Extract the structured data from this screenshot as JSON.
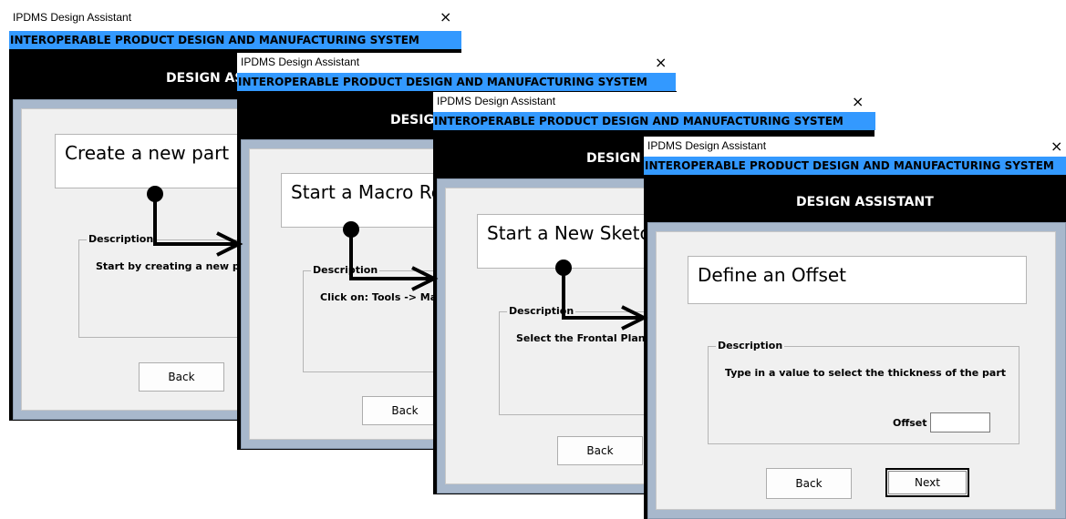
{
  "colors": {
    "banner_blue": "#3399ff",
    "black_band": "#000000",
    "frame_blue_gray": "#a8b8cc",
    "panel_gray": "#f0f0f0"
  },
  "windows": [
    {
      "title": "IPDMS Design Assistant",
      "close_icon": "×",
      "banner": "INTEROPERABLE PRODUCT DESIGN AND MANUFACTURING SYSTEM",
      "heading": "DESIGN ASSISTANT",
      "step": "Create a new part",
      "description_label": "Description",
      "description_text": "Start by creating a new part",
      "back_label": "Back"
    },
    {
      "title": "IPDMS Design Assistant",
      "close_icon": "×",
      "banner": "INTEROPERABLE PRODUCT DESIGN AND MANUFACTURING SYSTEM",
      "heading": "DESIGN ASSISTANT",
      "step": "Start a Macro Recording",
      "description_label": "Description",
      "description_text": "Click on: Tools -> Macro",
      "back_label": "Back"
    },
    {
      "title": "IPDMS Design Assistant",
      "close_icon": "×",
      "banner": "INTEROPERABLE PRODUCT DESIGN AND MANUFACTURING SYSTEM",
      "heading": "DESIGN ASSISTANT",
      "step": "Start a New Sketch",
      "description_label": "Description",
      "description_text": "Select the Frontal Plane to",
      "back_label": "Back"
    },
    {
      "title": "IPDMS Design Assistant",
      "close_icon": "×",
      "banner": "INTEROPERABLE PRODUCT DESIGN AND MANUFACTURING SYSTEM",
      "heading": "DESIGN ASSISTANT",
      "step": "Define an Offset",
      "description_label": "Description",
      "description_text": "Type in a value to select the thickness of the part",
      "offset_label": "Offset",
      "offset_value": "",
      "back_label": "Back",
      "next_label": "Next"
    }
  ]
}
